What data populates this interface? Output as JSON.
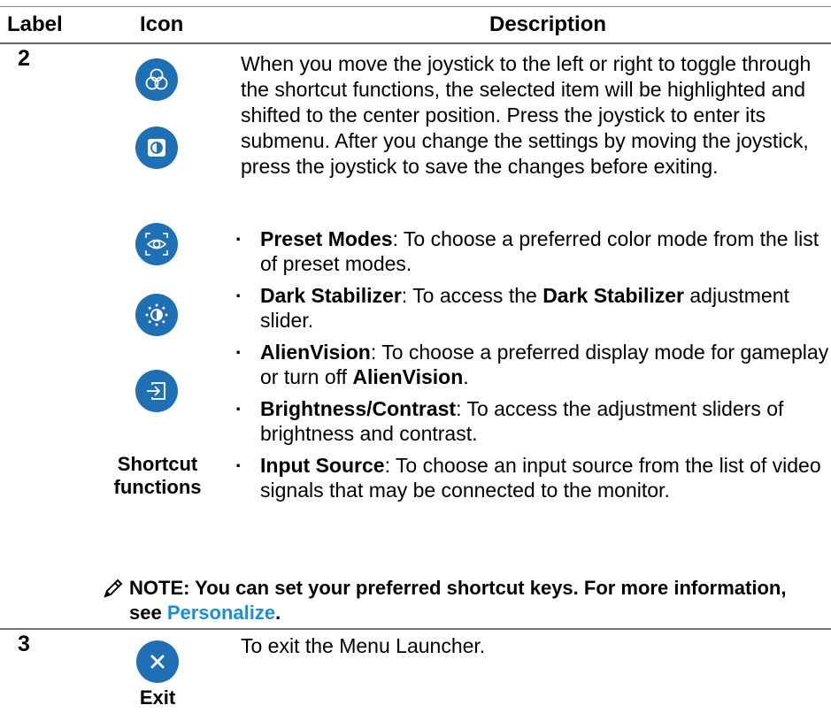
{
  "table": {
    "headers": {
      "label": "Label",
      "icon": "Icon",
      "description": "Description"
    }
  },
  "row2": {
    "label": "2",
    "icon_caption": "Shortcut functions",
    "icon_caption_line1": "Shortcut",
    "icon_caption_line2": "functions",
    "icons": [
      "preset-modes-icon",
      "dark-stabilizer-icon",
      "alienvision-icon",
      "brightness-contrast-icon",
      "input-source-icon"
    ],
    "intro": "When you move the joystick to the left or right to toggle through the shortcut functions, the selected item will be highlighted and shifted to the center position. Press the joystick to enter its submenu. After you change the settings by moving the joystick, press the joystick to save the changes before exiting.",
    "bullets": {
      "preset": {
        "term": "Preset Modes",
        "text": ": To choose a preferred color mode from the list of preset modes."
      },
      "dark": {
        "term": "Dark Stabilizer",
        "text_a": ": To access the ",
        "term2": "Dark Stabilizer",
        "text_b": " adjustment slider."
      },
      "alien": {
        "term": "AlienVision",
        "text_a": ": To choose a preferred display mode for gameplay or turn off ",
        "term2": "AlienVision",
        "text_b": "."
      },
      "bright": {
        "term": "Brightness/Contrast",
        "text": ": To access the adjustment sliders of brightness and contrast."
      },
      "input": {
        "term": "Input Source",
        "text": ": To choose an input source from the list of video signals that may be connected to the monitor."
      }
    },
    "note": {
      "text": "NOTE: You can set your preferred shortcut keys. For more information, see ",
      "link": "Personalize",
      "end": "."
    }
  },
  "row3": {
    "label": "3",
    "icon": "close-icon",
    "icon_caption": "Exit",
    "description": "To exit the Menu Launcher."
  },
  "colors": {
    "icon_blue": "#1f6fb5",
    "link_blue": "#1a8fd6"
  }
}
